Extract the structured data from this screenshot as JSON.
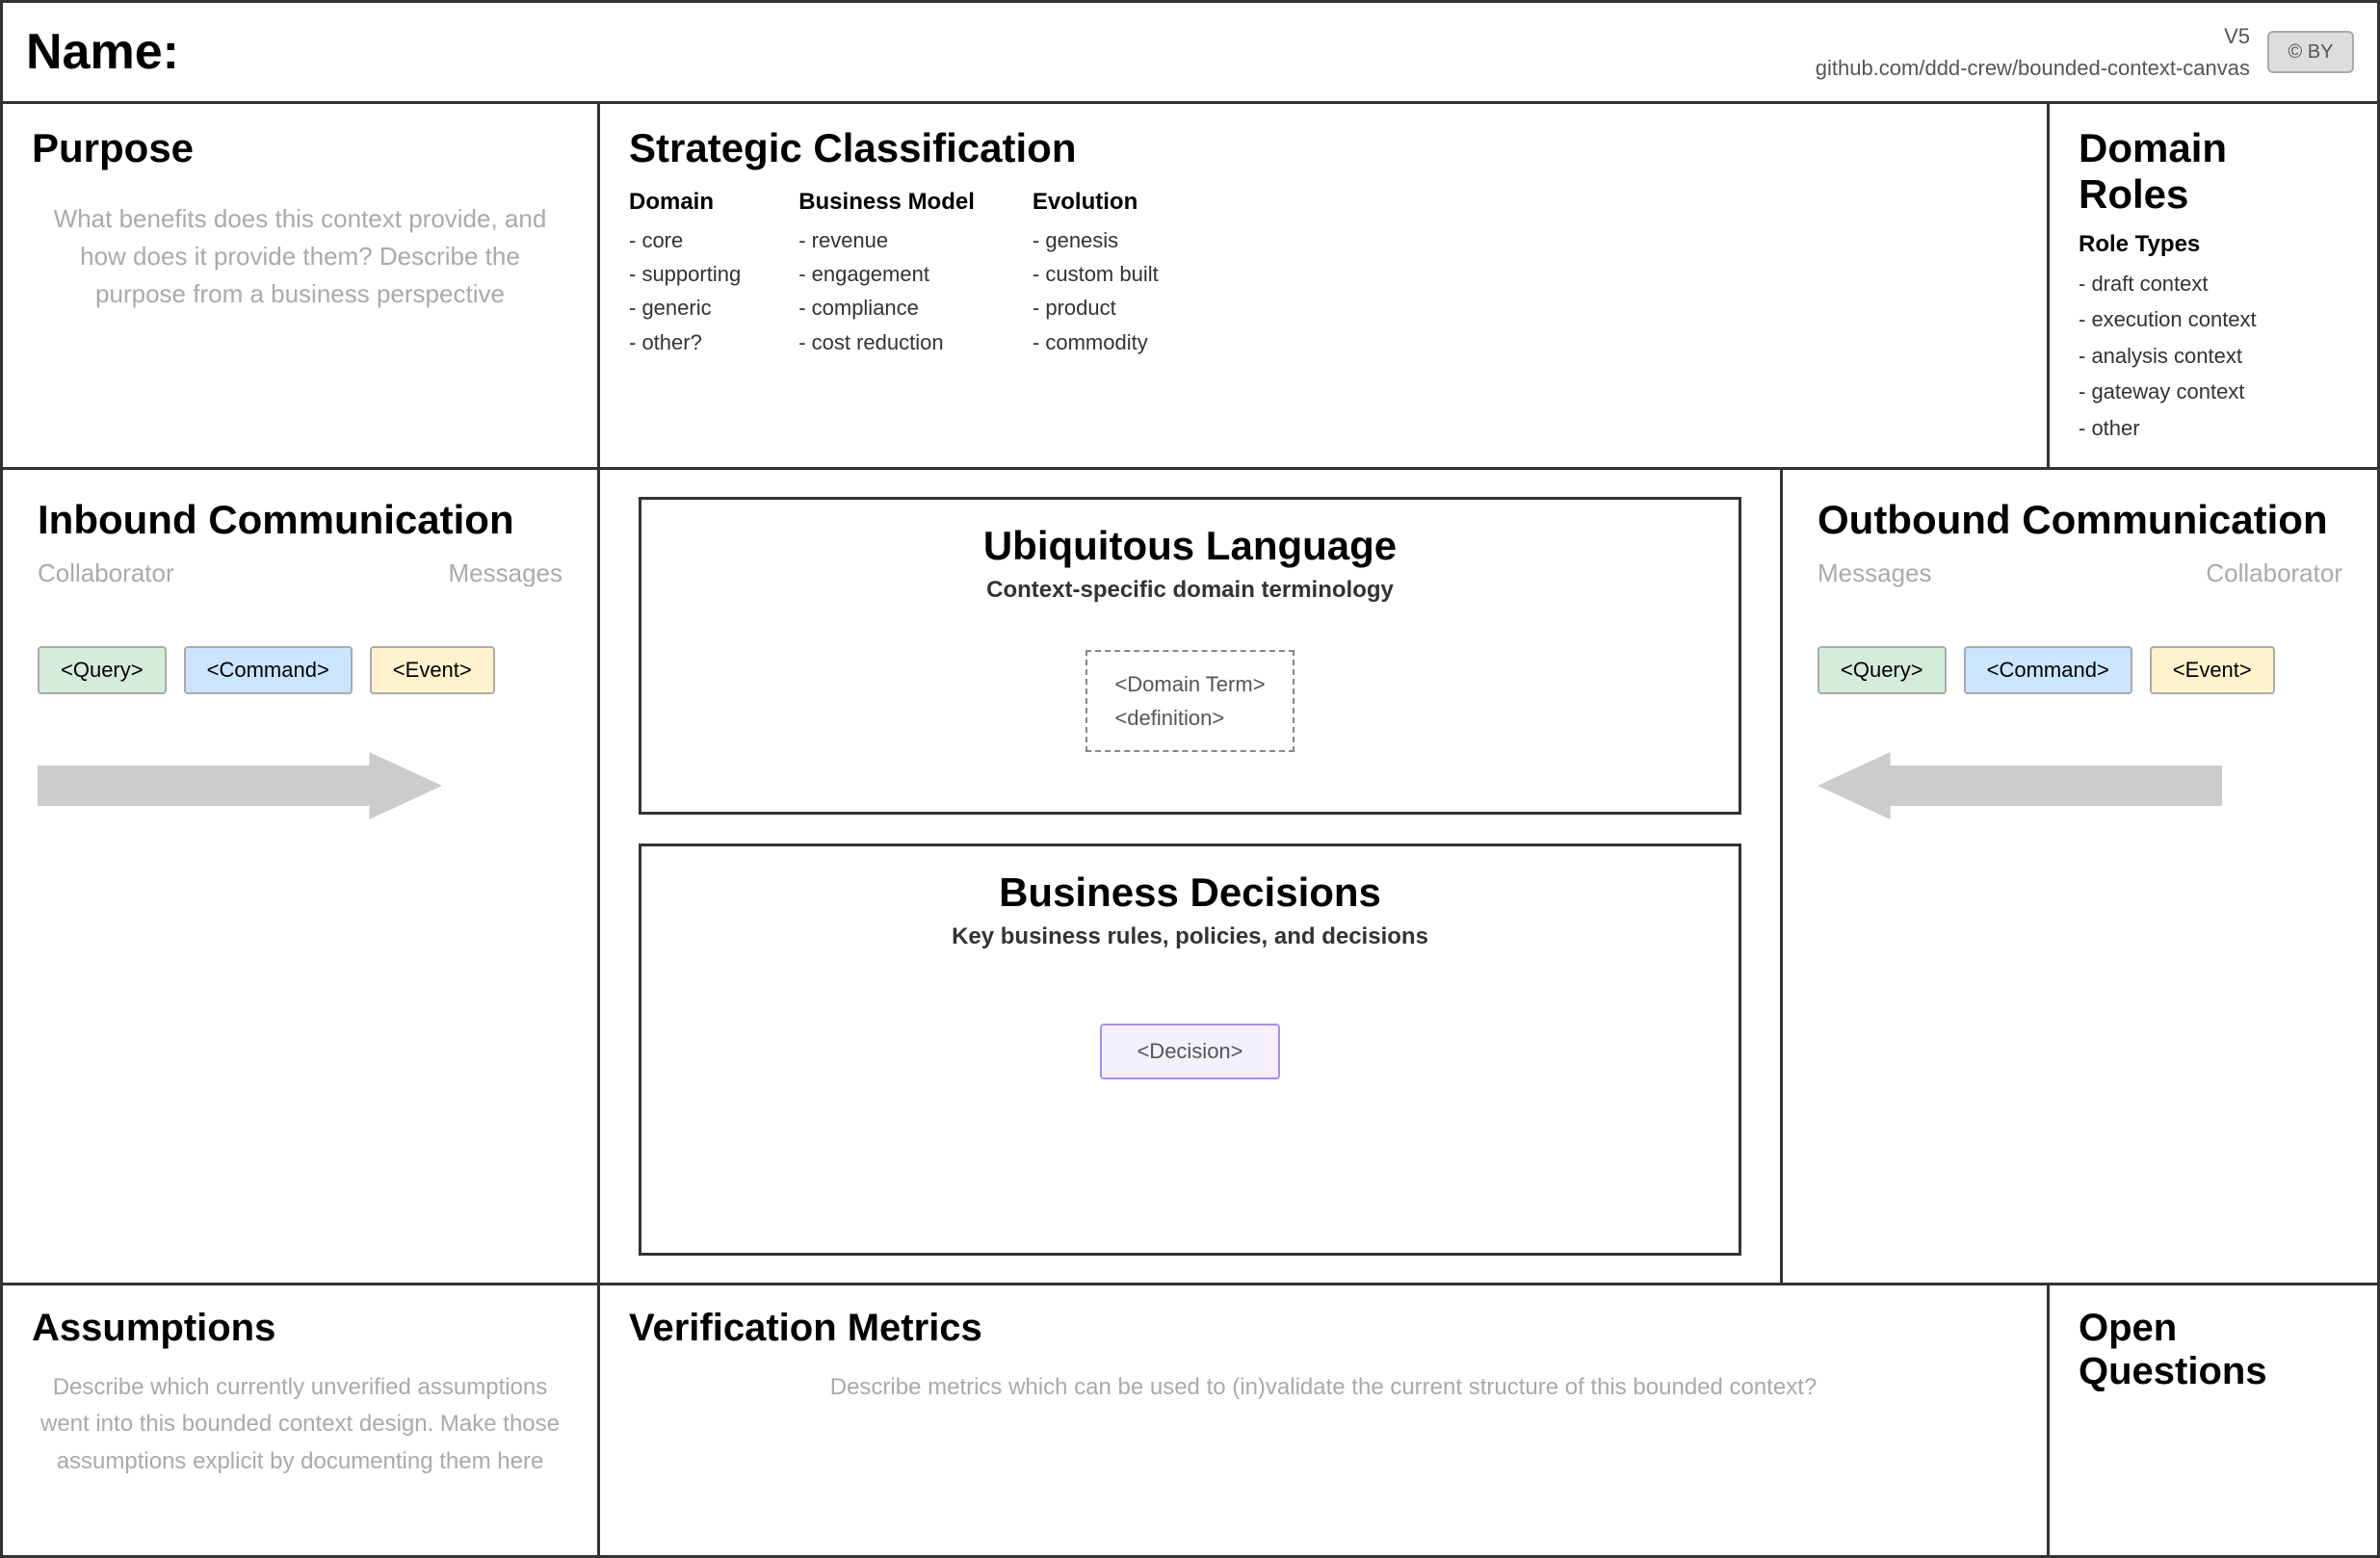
{
  "header": {
    "name_label": "Name:",
    "version": "V5",
    "github": "github.com/ddd-crew/bounded-context-canvas",
    "license_icon": "© BY"
  },
  "purpose": {
    "title": "Purpose",
    "hint": "What benefits does this context provide, and how does it provide them? Describe the purpose from a business perspective"
  },
  "strategic": {
    "title": "Strategic Classification",
    "domain": {
      "title": "Domain",
      "items": [
        "- core",
        "- supporting",
        "- generic",
        "- other?"
      ]
    },
    "business_model": {
      "title": "Business Model",
      "items": [
        "- revenue",
        "- engagement",
        "- compliance",
        "- cost reduction"
      ]
    },
    "evolution": {
      "title": "Evolution",
      "items": [
        "- genesis",
        "- custom built",
        "- product",
        "- commodity"
      ]
    }
  },
  "domain_roles": {
    "title": "Domain Roles",
    "role_types_label": "Role Types",
    "items": [
      "- draft context",
      "- execution context",
      "- analysis context",
      "- gateway context",
      "- other"
    ]
  },
  "inbound": {
    "title": "Inbound Communication",
    "collaborator_label": "Collaborator",
    "messages_label": "Messages",
    "query_label": "<Query>",
    "command_label": "<Command>",
    "event_label": "<Event>"
  },
  "outbound": {
    "title": "Outbound Communication",
    "messages_label": "Messages",
    "collaborator_label": "Collaborator",
    "query_label": "<Query>",
    "command_label": "<Command>",
    "event_label": "<Event>"
  },
  "ubiquitous_language": {
    "title": "Ubiquitous Language",
    "subtitle": "Context-specific domain terminology",
    "domain_term": "<Domain Term>",
    "definition": "<definition>"
  },
  "business_decisions": {
    "title": "Business Decisions",
    "subtitle": "Key business rules, policies, and decisions",
    "decision_label": "<Decision>"
  },
  "assumptions": {
    "title": "Assumptions",
    "hint": "Describe which currently unverified assumptions went into this bounded context design. Make those assumptions explicit by documenting them here"
  },
  "verification": {
    "title": "Verification Metrics",
    "hint": "Describe metrics which can be used to (in)validate the current structure of this bounded context?"
  },
  "open_questions": {
    "title": "Open Questions"
  }
}
